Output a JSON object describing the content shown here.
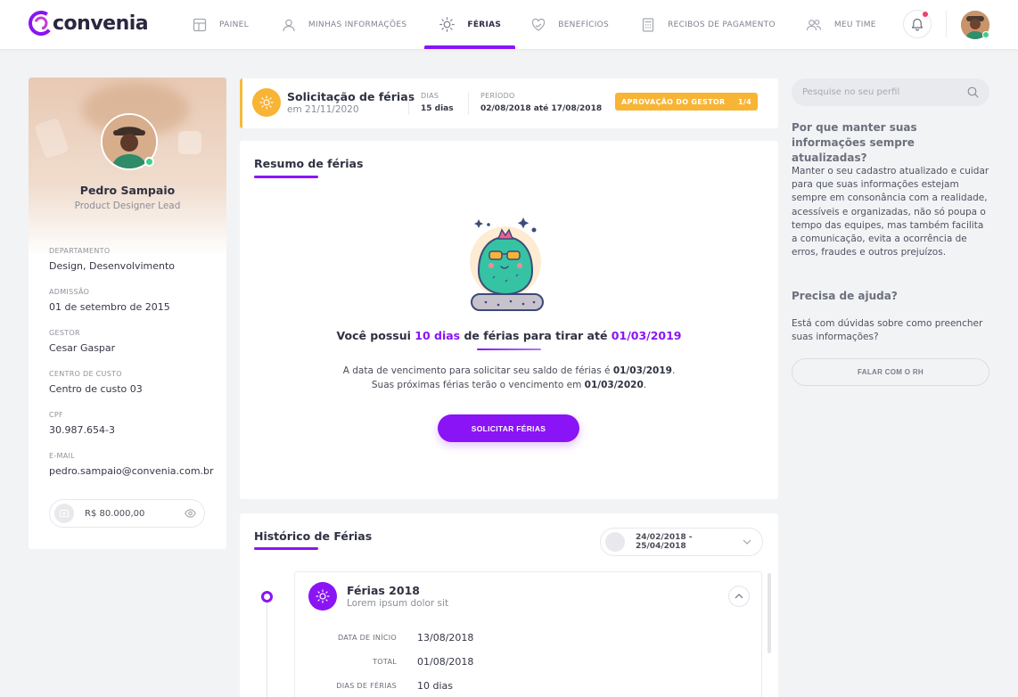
{
  "brand": {
    "name": "convenia",
    "accent": "#8a14f5",
    "warning": "#f8b434",
    "online": "#3ecf8e"
  },
  "nav": {
    "items": [
      {
        "label": "PAINEL",
        "icon": "dashboard-icon"
      },
      {
        "label": "MINHAS INFORMAÇÕES",
        "icon": "user-icon"
      },
      {
        "label": "FÉRIAS",
        "icon": "sun-icon",
        "active": true
      },
      {
        "label": "BENEFÍCIOS",
        "icon": "heart-icon"
      },
      {
        "label": "RECIBOS DE PAGAMENTO",
        "icon": "calculator-icon"
      },
      {
        "label": "MEU TIME",
        "icon": "team-icon"
      }
    ]
  },
  "profile": {
    "name": "Pedro Sampaio",
    "role": "Product Designer Lead",
    "fields": [
      {
        "label": "DEPARTAMENTO",
        "value": "Design, Desenvolvimento"
      },
      {
        "label": "ADMISSÃO",
        "value": "01 de setembro de 2015"
      },
      {
        "label": "GESTOR",
        "value": "Cesar Gaspar"
      },
      {
        "label": "CENTRO DE CUSTO",
        "value": "Centro de custo 03"
      },
      {
        "label": "CPF",
        "value": "30.987.654-3"
      },
      {
        "label": "E-MAIL",
        "value": "pedro.sampaio@convenia.com.br"
      }
    ],
    "salary": "R$ 80.000,00"
  },
  "request": {
    "title": "Solicitação de férias",
    "subtitle": "em 21/11/2020",
    "days_label": "DIAS",
    "days_value": "15 dias",
    "period_label": "PERÍODO",
    "period_value": "02/08/2018 até 17/08/2018",
    "status_label": "APROVAÇÃO DO GESTOR",
    "status_step": "1/4"
  },
  "summary": {
    "title": "Resumo de férias",
    "main_prefix": "Você possui ",
    "main_days": "10 dias",
    "main_middle": " de férias para tirar até ",
    "main_date": "01/03/2019",
    "desc_1": "A data de vencimento para solicitar seu saldo de férias é ",
    "desc_date1": "01/03/2019",
    "desc_2": ". Suas próximas férias terão o vencimento em ",
    "desc_date2": "01/03/2020",
    "desc_3": ".",
    "button": "SOLICITAR FÉRIAS"
  },
  "history": {
    "title": "Histórico de Férias",
    "date_range": "24/02/2018 - 25/04/2018",
    "entry": {
      "title": "Férias 2018",
      "subtitle": "Lorem ipsum dolor sit",
      "rows": [
        {
          "label": "DATA DE INÍCIO",
          "value": "13/08/2018"
        },
        {
          "label": "TOTAL",
          "value": "01/08/2018"
        },
        {
          "label": "DIAS DE FÉRIAS",
          "value": "10 dias"
        }
      ]
    }
  },
  "sidebar": {
    "search_placeholder": "Pesquise no seu perfil",
    "why_title": "Por que manter suas informações sempre atualizadas?",
    "why_text": "Manter o seu cadastro atualizado e cuidar para que suas informações estejam sempre em consonância com a realidade, acessíveis e organizadas, não só poupa o tempo das equipes, mas também facilita a comunicação, evita a ocorrência de erros, fraudes e outros prejuízos.",
    "help_title": "Precisa de ajuda?",
    "help_text": "Está com dúvidas sobre  como preencher suas informações?",
    "help_button": "FALAR COM O RH"
  }
}
